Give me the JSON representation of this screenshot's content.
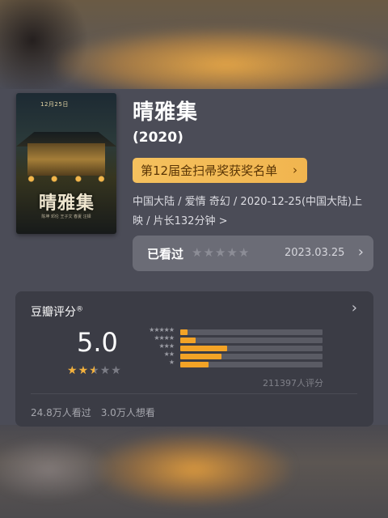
{
  "movie": {
    "title": "晴雅集",
    "year": "(2020)",
    "award_label": "第12届金扫帚奖获奖名单",
    "meta_line1": "中国大陆 / 爱情 奇幻 / 2020-12-25(中国大陆)上",
    "meta_line2": "映 / 片长132分钟 >"
  },
  "poster": {
    "date_tag": "12月25日",
    "title": "晴雅集",
    "credits": "陈坤 邓伦 王子文 春夏 汪铎"
  },
  "seen": {
    "label": "已看过",
    "stars_filled": 0,
    "stars_total": 5,
    "date": "2023.03.25"
  },
  "rating": {
    "title": "豆瓣评分",
    "title_mark": "®",
    "score": "5.0",
    "stars_value": 2.5,
    "distribution": [
      {
        "stars": 5,
        "fraction": 0.05
      },
      {
        "stars": 4,
        "fraction": 0.11
      },
      {
        "stars": 3,
        "fraction": 0.33
      },
      {
        "stars": 2,
        "fraction": 0.29
      },
      {
        "stars": 1,
        "fraction": 0.2
      }
    ],
    "total": "211397人评分",
    "seen_count": "24.8万人看过",
    "want_count": "3.0万人想看"
  },
  "colors": {
    "accent": "#f3b13d",
    "award_bg": "#f5c15e",
    "card_bg": "#3b3c45"
  },
  "icons": {
    "chevron": "chevron-right-icon",
    "star": "star-icon"
  }
}
